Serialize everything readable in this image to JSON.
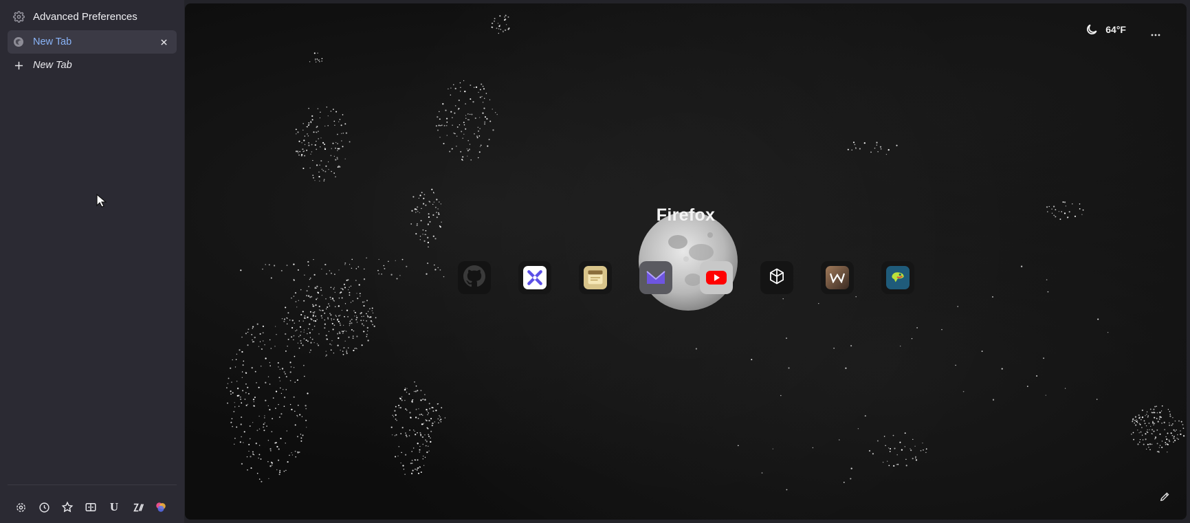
{
  "sidebar": {
    "preferences_label": "Advanced Preferences",
    "active_tab_label": "New Tab",
    "new_tab_label": "New Tab",
    "toolbar_icons": [
      "settings-icon",
      "history-icon",
      "bookmarks-icon",
      "split-view-icon",
      "u-icon",
      "zen-icon",
      "colors-icon"
    ],
    "u_glyph": "U"
  },
  "main": {
    "weather_temp": "64°F",
    "brand_title": "Firefox",
    "shortcuts": [
      "github",
      "tool",
      "notes",
      "mail",
      "youtube",
      "openai",
      "w-app",
      "frog-app"
    ],
    "accent_colors": {
      "youtube": "#ff0000",
      "mail": "#6e55e0",
      "tool": "#5b4fe6",
      "frog": "#1f5b7a"
    }
  }
}
